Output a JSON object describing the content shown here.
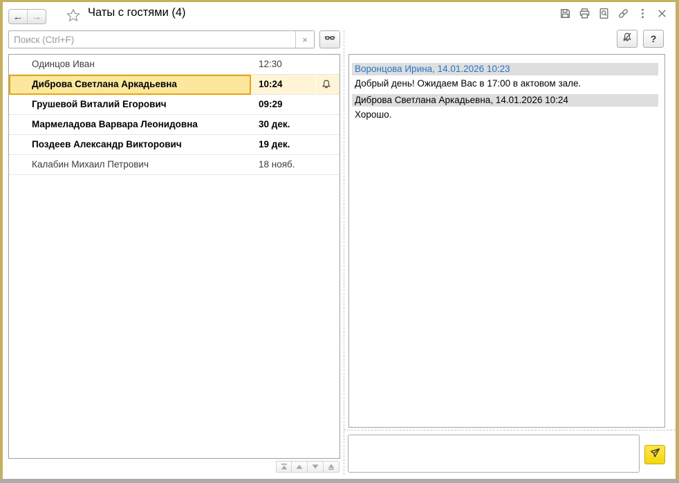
{
  "window": {
    "title": "Чаты с гостями (4)",
    "nav": {
      "back": "←",
      "forward": "→"
    },
    "help_label": "?"
  },
  "search": {
    "placeholder": "Поиск (Ctrl+F)",
    "clear": "×"
  },
  "chat_list": {
    "rows": [
      {
        "name": "Одинцов Иван",
        "time": "12:30",
        "unread": false,
        "selected": false,
        "bell": false
      },
      {
        "name": "Диброва Светлана Аркадьевна",
        "time": "10:24",
        "unread": true,
        "selected": true,
        "bell": true
      },
      {
        "name": "Грушевой Виталий Егорович",
        "time": "09:29",
        "unread": true,
        "selected": false,
        "bell": false
      },
      {
        "name": "Мармеладова Варвара Леонидовна",
        "time": "30 дек.",
        "unread": true,
        "selected": false,
        "bell": false
      },
      {
        "name": "Поздеев Александр Викторович",
        "time": "19 дек.",
        "unread": true,
        "selected": false,
        "bell": false
      },
      {
        "name": "Калабин Михаил Петрович",
        "time": "18 нояб.",
        "unread": false,
        "selected": false,
        "bell": false
      }
    ]
  },
  "conversation": {
    "messages": [
      {
        "header": "Воронцова Ирина, 14.01.2026 10:23",
        "outgoing": false,
        "text": "Добрый день! Ожидаем Вас в 17:00 в актовом зале."
      },
      {
        "header": "Диброва Светлана Аркадьевна, 14.01.2026 10:24",
        "outgoing": true,
        "text": "Хорошо."
      }
    ],
    "input_value": ""
  },
  "colors": {
    "window_border": "#C4B160",
    "selected_cell_bg": "#FBE79E",
    "selected_cell_border": "#E7A50C",
    "selected_row_bg": "#FFF5D6",
    "message_header_bg": "#DEDEDE",
    "header_link_blue": "#2874C7",
    "send_button_yellow": "#F8DC1C"
  }
}
